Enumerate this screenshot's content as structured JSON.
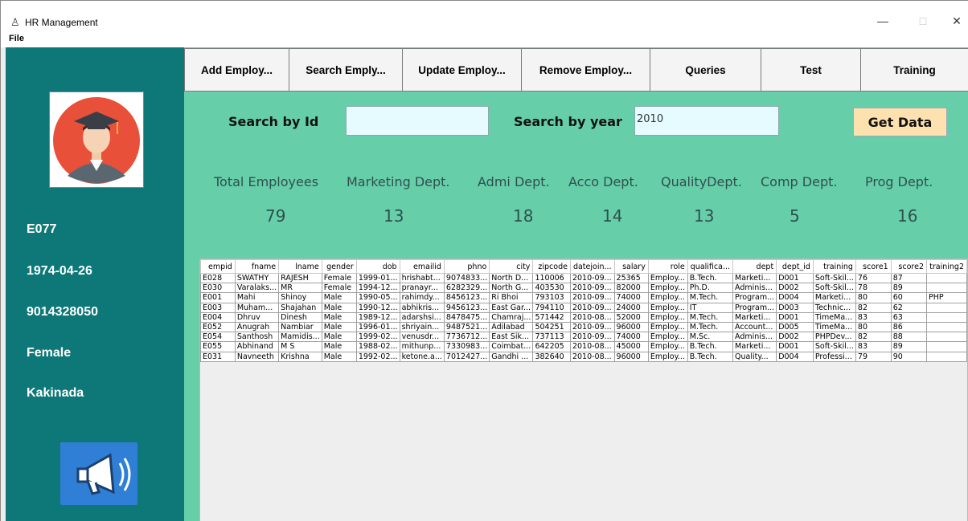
{
  "window": {
    "title": "HR Management",
    "minimize": "—",
    "maximize": "□",
    "close": "✕"
  },
  "menu": {
    "file": "File"
  },
  "sidebar": {
    "emp_id": "E077",
    "dob": "1974-04-26",
    "phone": "9014328050",
    "gender": "Female",
    "city": "Kakinada"
  },
  "tabs": [
    {
      "label": "Add Employ..."
    },
    {
      "label": "Search Emply..."
    },
    {
      "label": "Update Employ..."
    },
    {
      "label": "Remove Employ..."
    },
    {
      "label": "Queries"
    },
    {
      "label": "Test"
    },
    {
      "label": "Training"
    }
  ],
  "search": {
    "by_id_label": "Search by Id",
    "by_id_value": "",
    "by_year_label": "Search by year",
    "by_year_value": "2010",
    "get_data": "Get Data"
  },
  "stats": [
    {
      "label": "Total Employees",
      "value": "79"
    },
    {
      "label": "Marketing Dept.",
      "value": "13"
    },
    {
      "label": "Admi Dept.",
      "value": "18"
    },
    {
      "label": "Acco Dept.",
      "value": "14"
    },
    {
      "label": "QualityDept.",
      "value": "13"
    },
    {
      "label": "Comp Dept.",
      "value": "5"
    },
    {
      "label": "Prog Dept.",
      "value": "16"
    }
  ],
  "table": {
    "columns": [
      "empid",
      "fname",
      "lname",
      "gender",
      "dob",
      "emailid",
      "phno",
      "city",
      "zipcode",
      "datejoin...",
      "salary",
      "role",
      "qualifica...",
      "dept",
      "dept_id",
      "training",
      "score1",
      "score2",
      "training2"
    ],
    "rows": [
      [
        "E028",
        "SWATHY",
        "RAJESH",
        "Female",
        "1999-01...",
        "hrishabt...",
        "9074833...",
        "North D...",
        "110006",
        "2010-09...",
        "25365",
        "Employ...",
        "B.Tech.",
        "Marketi...",
        "D001",
        "Soft-Skil...",
        "76",
        "87",
        ""
      ],
      [
        "E030",
        "Varalaks...",
        "MR",
        "Female",
        "1994-12...",
        "pranayr...",
        "6282329...",
        "North G...",
        "403530",
        "2010-09...",
        "82000",
        "Employ...",
        "Ph.D.",
        "Adminis...",
        "D002",
        "Soft-Skil...",
        "78",
        "89",
        ""
      ],
      [
        "E001",
        "Mahi",
        "Shinoy",
        "Male",
        "1990-05...",
        "rahimdy...",
        "8456123...",
        "Ri Bhoi",
        "793103",
        "2010-09...",
        "74000",
        "Employ...",
        "M.Tech.",
        "Program...",
        "D004",
        "Marketi...",
        "80",
        "60",
        "PHP"
      ],
      [
        "E003",
        "Muham...",
        "Shajahan",
        "Male",
        "1990-12...",
        "abhikris...",
        "9456123...",
        "East Gar...",
        "794110",
        "2010-09...",
        "24000",
        "Employ...",
        "IT",
        "Program...",
        "D003",
        "Technic...",
        "82",
        "62",
        ""
      ],
      [
        "E004",
        "Dhruv",
        "Dinesh",
        "Male",
        "1989-12...",
        "adarshsi...",
        "8478475...",
        "Chamraj...",
        "571442",
        "2010-08...",
        "52000",
        "Employ...",
        "M.Tech.",
        "Marketi...",
        "D001",
        "TimeMa...",
        "83",
        "63",
        ""
      ],
      [
        "E052",
        "Anugrah",
        "Nambiar",
        "Male",
        "1996-01...",
        "shriyain...",
        "9487521...",
        "Adilabad",
        "504251",
        "2010-09...",
        "96000",
        "Employ...",
        "M.Tech.",
        "Account...",
        "D005",
        "TimeMa...",
        "80",
        "86",
        ""
      ],
      [
        "E054",
        "Santhosh",
        "Mamidis...",
        "Male",
        "1999-02...",
        "venusdr...",
        "7736712...",
        "East Sik...",
        "737113",
        "2010-09...",
        "74000",
        "Employ...",
        "M.Sc.",
        "Adminis...",
        "D002",
        "PHPDev...",
        "82",
        "88",
        ""
      ],
      [
        "E055",
        "Abhinand",
        "M S",
        "Male",
        "1988-02...",
        "mithunp...",
        "7330983...",
        "Coimbat...",
        "642205",
        "2010-08...",
        "45000",
        "Employ...",
        "B.Tech.",
        "Marketi...",
        "D001",
        "Soft-Skil...",
        "83",
        "89",
        ""
      ],
      [
        "E031",
        "Navneeth",
        "Krishna",
        "Male",
        "1992-02...",
        "ketone.a...",
        "7012427...",
        "Gandhi ...",
        "382640",
        "2010-08...",
        "96000",
        "Employ...",
        "B.Tech.",
        "Quality...",
        "D004",
        "Professi...",
        "79",
        "90",
        ""
      ]
    ]
  }
}
